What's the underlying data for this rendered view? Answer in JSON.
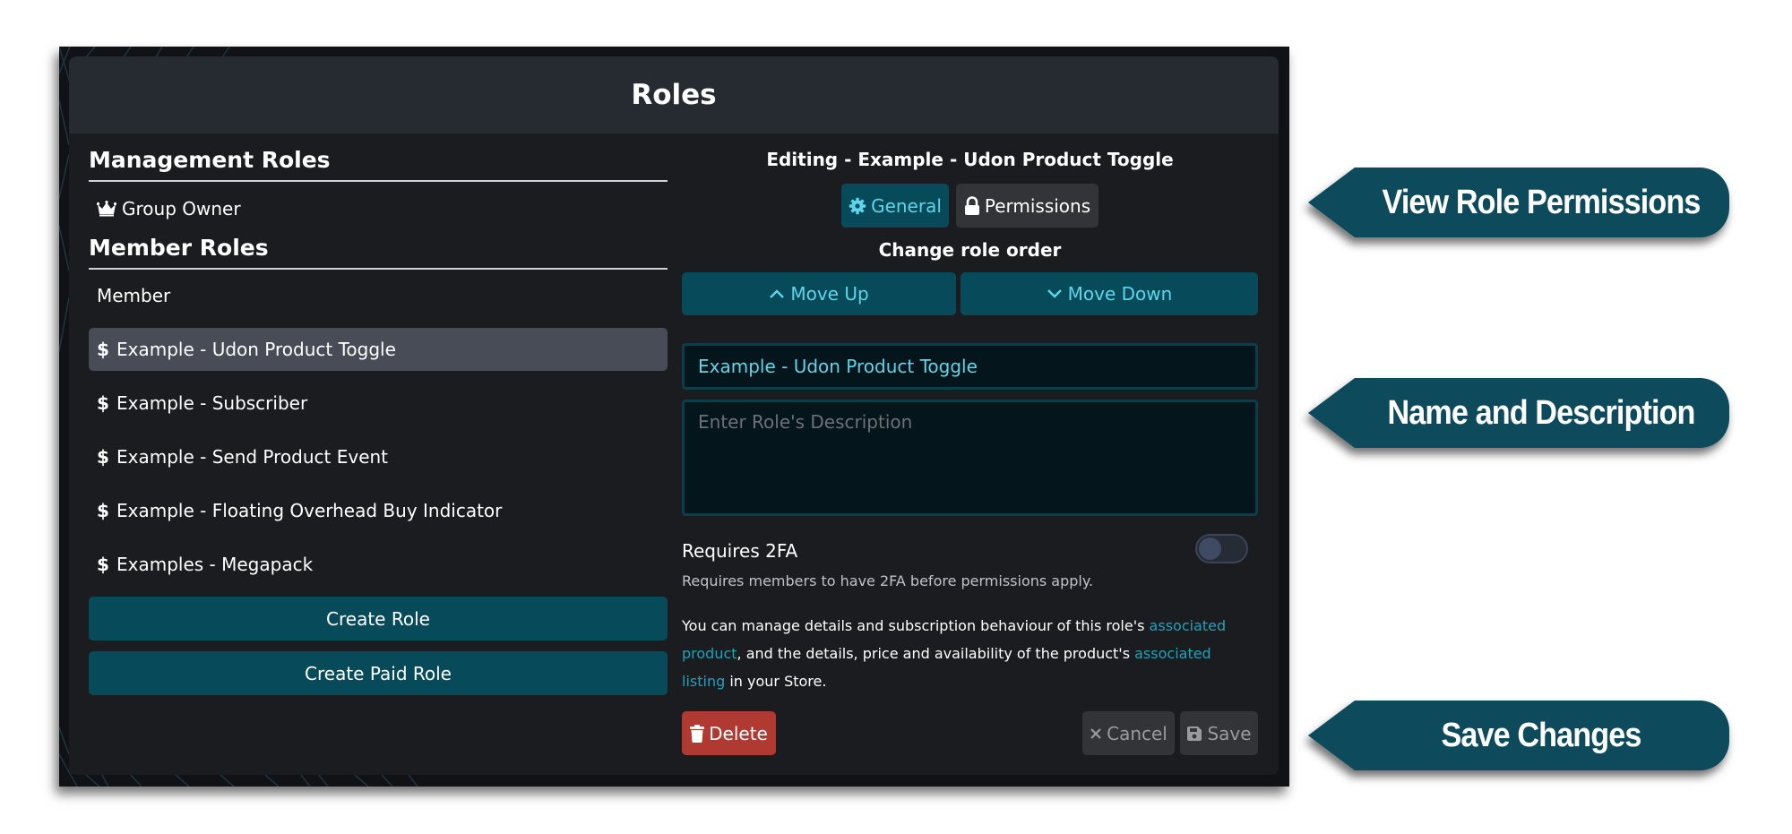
{
  "panel": {
    "title": "Roles"
  },
  "left": {
    "management_heading": "Management Roles",
    "management_roles": [
      {
        "label": "Group Owner",
        "icon": "crown-icon"
      }
    ],
    "member_heading": "Member Roles",
    "member_roles": [
      {
        "label": "Member",
        "icon": "",
        "selected": false
      },
      {
        "label": "Example - Udon Product Toggle",
        "icon": "$",
        "selected": true
      },
      {
        "label": "Example - Subscriber",
        "icon": "$",
        "selected": false
      },
      {
        "label": "Example - Send Product Event",
        "icon": "$",
        "selected": false
      },
      {
        "label": "Example - Floating Overhead Buy Indicator",
        "icon": "$",
        "selected": false
      },
      {
        "label": "Examples - Megapack",
        "icon": "$",
        "selected": false
      }
    ],
    "create_role_label": "Create Role",
    "create_paid_role_label": "Create Paid Role"
  },
  "editor": {
    "title": "Editing - Example - Udon Product Toggle",
    "tabs": [
      {
        "label": "General",
        "icon": "gear-icon",
        "active": true
      },
      {
        "label": "Permissions",
        "icon": "lock-icon",
        "active": false
      }
    ],
    "order_heading": "Change role order",
    "move_up_label": "Move Up",
    "move_down_label": "Move Down",
    "name_value": "Example - Udon Product Toggle",
    "description_value": "",
    "description_placeholder": "Enter Role's Description",
    "requires_2fa_label": "Requires 2FA",
    "requires_2fa_enabled": false,
    "requires_2fa_help": "Requires members to have 2FA before permissions apply.",
    "info": {
      "part1": "You can manage details and subscription behaviour of this role's ",
      "link1": "associated product",
      "part2": ", and the details, price and availability of the product's ",
      "link2": "associated listing",
      "part3": " in your Store."
    },
    "delete_label": "Delete",
    "cancel_label": "Cancel",
    "save_label": "Save"
  },
  "callouts": [
    {
      "label": "View Role Permissions"
    },
    {
      "label": "Name and Description"
    },
    {
      "label": "Save Changes"
    }
  ],
  "colors": {
    "accent_teal": "#074b5b",
    "accent_cyan": "#5fd5ea",
    "link": "#1fa2bb",
    "danger": "#b03a32"
  }
}
